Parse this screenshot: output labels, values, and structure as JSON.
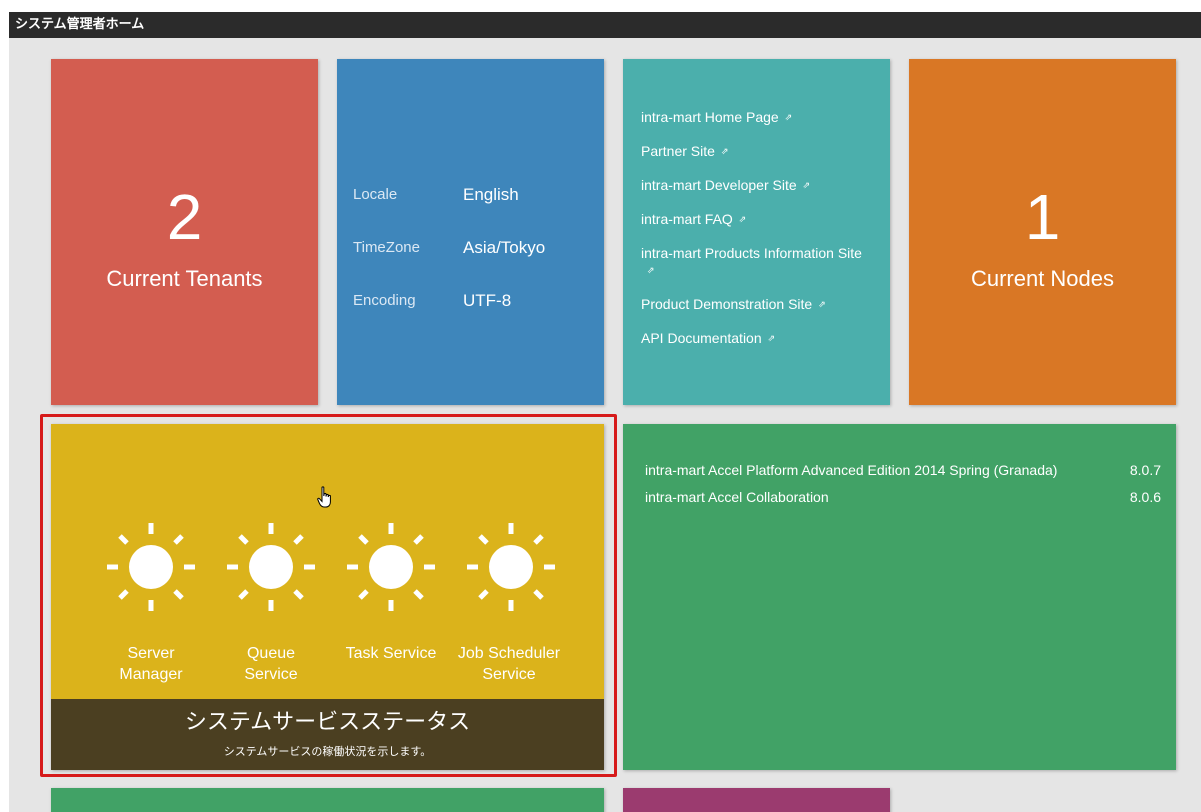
{
  "page": {
    "title": "システム管理者ホーム"
  },
  "tenants": {
    "count": "2",
    "label": "Current Tenants"
  },
  "locale": {
    "rows": [
      {
        "key": "Locale",
        "value": "English"
      },
      {
        "key": "TimeZone",
        "value": "Asia/Tokyo"
      },
      {
        "key": "Encoding",
        "value": "UTF-8"
      }
    ]
  },
  "links": {
    "items": [
      {
        "label": "intra-mart Home Page"
      },
      {
        "label": "Partner Site"
      },
      {
        "label": "intra-mart Developer Site"
      },
      {
        "label": "intra-mart FAQ"
      },
      {
        "label": "intra-mart Products Information Site"
      },
      {
        "label": "Product Demonstration Site"
      },
      {
        "label": "API Documentation"
      }
    ],
    "ext_icon": "external-link-icon"
  },
  "nodes": {
    "count": "1",
    "label": "Current Nodes"
  },
  "system_status": {
    "services": [
      {
        "label_line1": "Server",
        "label_line2": "Manager",
        "icon": "sun-icon"
      },
      {
        "label_line1": "Queue",
        "label_line2": "Service",
        "icon": "sun-icon"
      },
      {
        "label_line1": "Task Service",
        "label_line2": "",
        "icon": "sun-icon"
      },
      {
        "label_line1": "Job Scheduler",
        "label_line2": "Service",
        "icon": "sun-icon"
      }
    ],
    "title": "システムサービスステータス",
    "description": "システムサービスの稼働状況を示します。"
  },
  "products": {
    "items": [
      {
        "name": "intra-mart Accel Platform Advanced Edition 2014 Spring (Granada)",
        "version": "8.0.7"
      },
      {
        "name": "intra-mart Accel Collaboration",
        "version": "8.0.6"
      }
    ]
  },
  "colors": {
    "tenants": "#d35d50",
    "locale": "#3e86bb",
    "links": "#4bafac",
    "nodes": "#d97725",
    "status": "#dbb31b",
    "status_footer": "#4b3f21",
    "products": "#41a266",
    "bottom_tile": "#9b3b6f",
    "highlight": "#d61a1a"
  }
}
